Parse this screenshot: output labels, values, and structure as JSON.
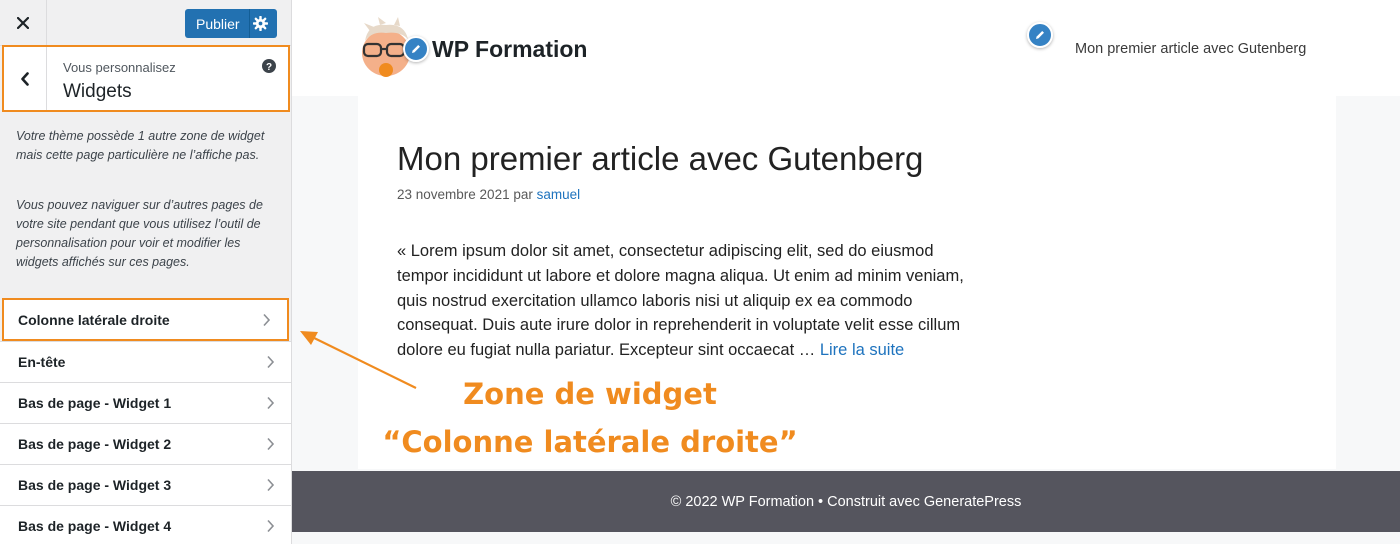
{
  "customizer": {
    "close_label": "×",
    "publish_label": "Publier",
    "section": {
      "subtitle": "Vous personnalisez",
      "title": "Widgets"
    },
    "description_1": "Votre thème possède 1 autre zone de widget mais cette page particulière ne l’affiche pas.",
    "description_2": "Vous pouvez naviguer sur d’autres pages de votre site pendant que vous utilisez l’outil de personnalisation pour voir et modifier les widgets affichés sur ces pages.",
    "widget_areas": [
      {
        "label": "Colonne latérale droite"
      },
      {
        "label": "En-tête"
      },
      {
        "label": "Bas de page - Widget 1"
      },
      {
        "label": "Bas de page - Widget 2"
      },
      {
        "label": "Bas de page - Widget 3"
      },
      {
        "label": "Bas de page - Widget 4"
      }
    ]
  },
  "site": {
    "title": "WP Formation",
    "nav_link": "Mon premier article avec Gutenberg",
    "post": {
      "title": "Mon premier article avec Gutenberg",
      "date": "23 novembre 2021",
      "by": "par",
      "author": "samuel",
      "excerpt": "« Lorem ipsum dolor sit amet, consectetur adipiscing elit, sed do eiusmod tempor incididunt ut labore et dolore magna aliqua. Ut enim ad minim veniam, quis nostrud exercitation ullamco laboris nisi ut aliquip ex ea commodo consequat. Duis aute irure dolor in reprehenderit in voluptate velit esse cillum dolore eu fugiat nulla pariatur. Excepteur sint occaecat …",
      "read_more": "Lire la suite"
    },
    "footer": "© 2022 WP Formation • Construit avec GeneratePress"
  },
  "annotation": {
    "line1": "Zone de widget",
    "line2": "“Colonne latérale droite”"
  },
  "colors": {
    "accent_orange": "#f08b1f",
    "wp_blue": "#2271b1",
    "link_blue": "#1e73be",
    "footer_bg": "#55555e"
  }
}
